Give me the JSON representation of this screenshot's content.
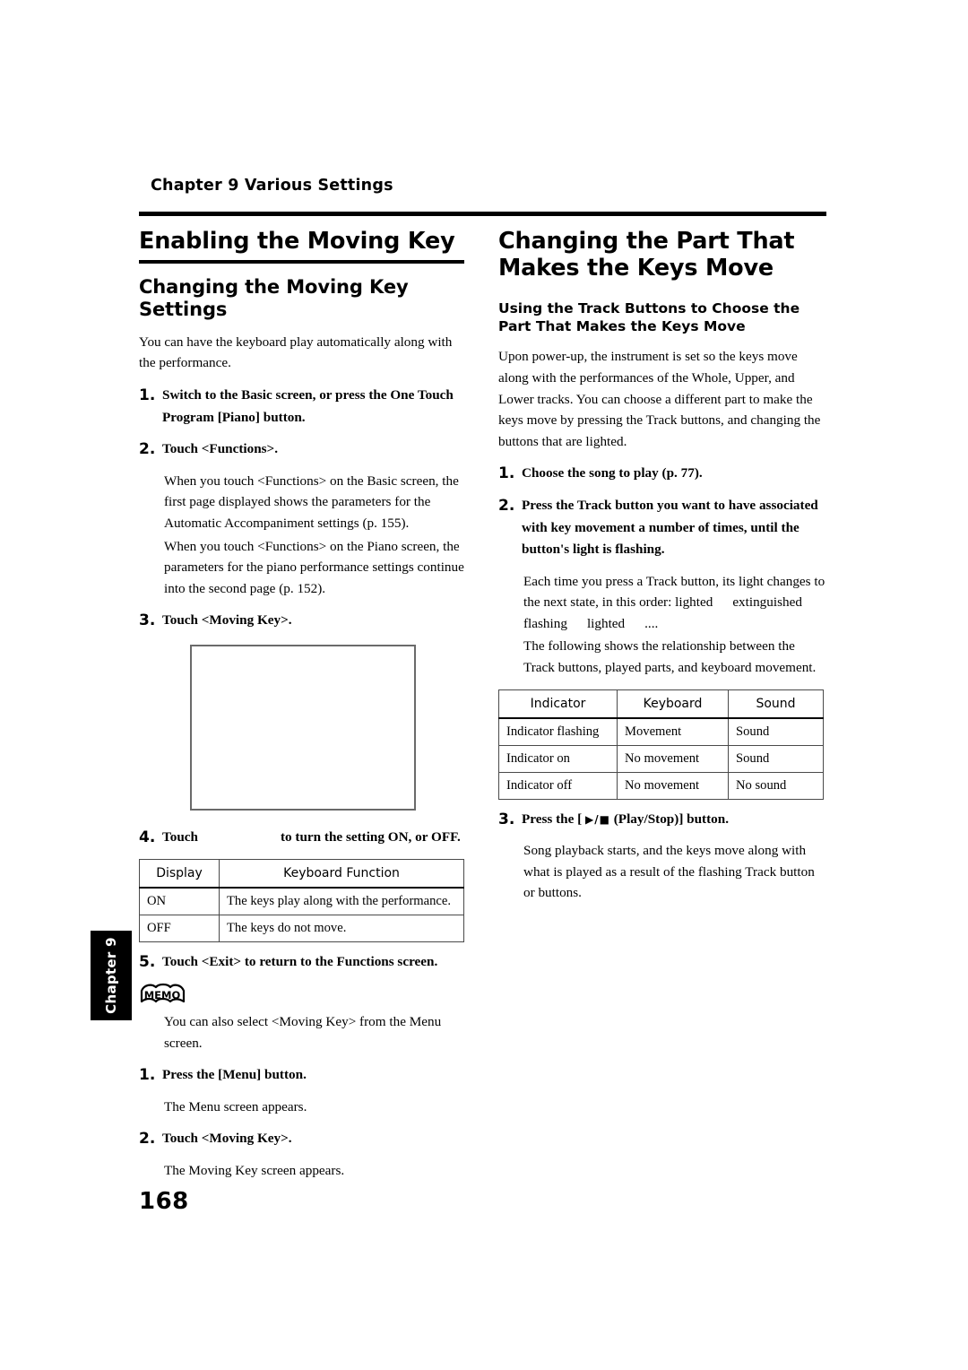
{
  "running_head": "Chapter 9 Various Settings",
  "page_number": "168",
  "chapter_tab": "Chapter 9",
  "left_column": {
    "section_title": "Enabling the Moving Key",
    "subsection_title": "Changing the Moving Key Settings",
    "intro": "You can have the keyboard play automatically along with the performance.",
    "step1_num": "1.",
    "step1_text": "Switch to the Basic screen, or press the One Touch Program [Piano] button.",
    "step2_num": "2.",
    "step2_text": "Touch <Functions>.",
    "step2_body_a": "When you touch <Functions> on the Basic screen, the first page displayed shows the parameters for the Automatic Accompaniment settings (p. 155).",
    "step2_body_b": "When you touch <Functions> on the Piano screen, the parameters for the piano performance settings continue into the second page (p. 152).",
    "step3_num": "3.",
    "step3_text": "Touch <Moving Key>.",
    "step4_num": "4.",
    "step4_text_before": "Touch",
    "step4_text_after": "to turn the setting ON, or OFF.",
    "table": {
      "headers": [
        "Display",
        "Keyboard Function"
      ],
      "rows": [
        [
          "ON",
          "The keys play along with the performance."
        ],
        [
          "OFF",
          "The keys do not move."
        ]
      ]
    },
    "step5_num": "5.",
    "step5_text": "Touch <Exit> to return to the Functions screen.",
    "memo_label": "MEMO",
    "memo_body": "You can also select <Moving Key> from the Menu screen.",
    "memo_step1_num": "1.",
    "memo_step1_text": "Press the [Menu] button.",
    "memo_step1_body": "The Menu screen appears.",
    "memo_step2_num": "2.",
    "memo_step2_text": "Touch <Moving Key>.",
    "memo_step2_body": "The Moving Key screen appears."
  },
  "right_column": {
    "section_title": "Changing the Part That Makes the Keys Move",
    "subsection_title": "Using the Track Buttons to Choose the Part That Makes the Keys Move",
    "intro": "Upon power-up, the instrument is set so the keys move along with the performances of the Whole, Upper, and Lower tracks. You can choose a different part to make the keys move by pressing the Track buttons, and changing the buttons that are lighted.",
    "step1_num": "1.",
    "step1_text": "Choose the song to play (p. 77).",
    "step2_num": "2.",
    "step2_text": "Press the Track button you want to have associated with key movement a number of times, until the button's light is flashing.",
    "step2_body_a1": "Each time you press a Track button, its light changes to the next state, in this order: lighted",
    "step2_body_a2": "extinguished",
    "step2_body_a3": "flashing",
    "step2_body_a4": "lighted",
    "step2_body_a5": "....",
    "step2_body_b": "The following shows the relationship between the Track buttons, played parts, and keyboard movement.",
    "table": {
      "headers": [
        "Indicator",
        "Keyboard",
        "Sound"
      ],
      "rows": [
        [
          "Indicator flashing",
          "Movement",
          "Sound"
        ],
        [
          "Indicator on",
          "No movement",
          "Sound"
        ],
        [
          "Indicator off",
          "No movement",
          "No sound"
        ]
      ]
    },
    "step3_num": "3.",
    "step3_text_before": "Press the [",
    "step3_glyph": "▶/■",
    "step3_text_after": "(Play/Stop)] button.",
    "step3_body": "Song playback starts, and the keys move along with what is played as a result of the flashing Track button or buttons."
  }
}
